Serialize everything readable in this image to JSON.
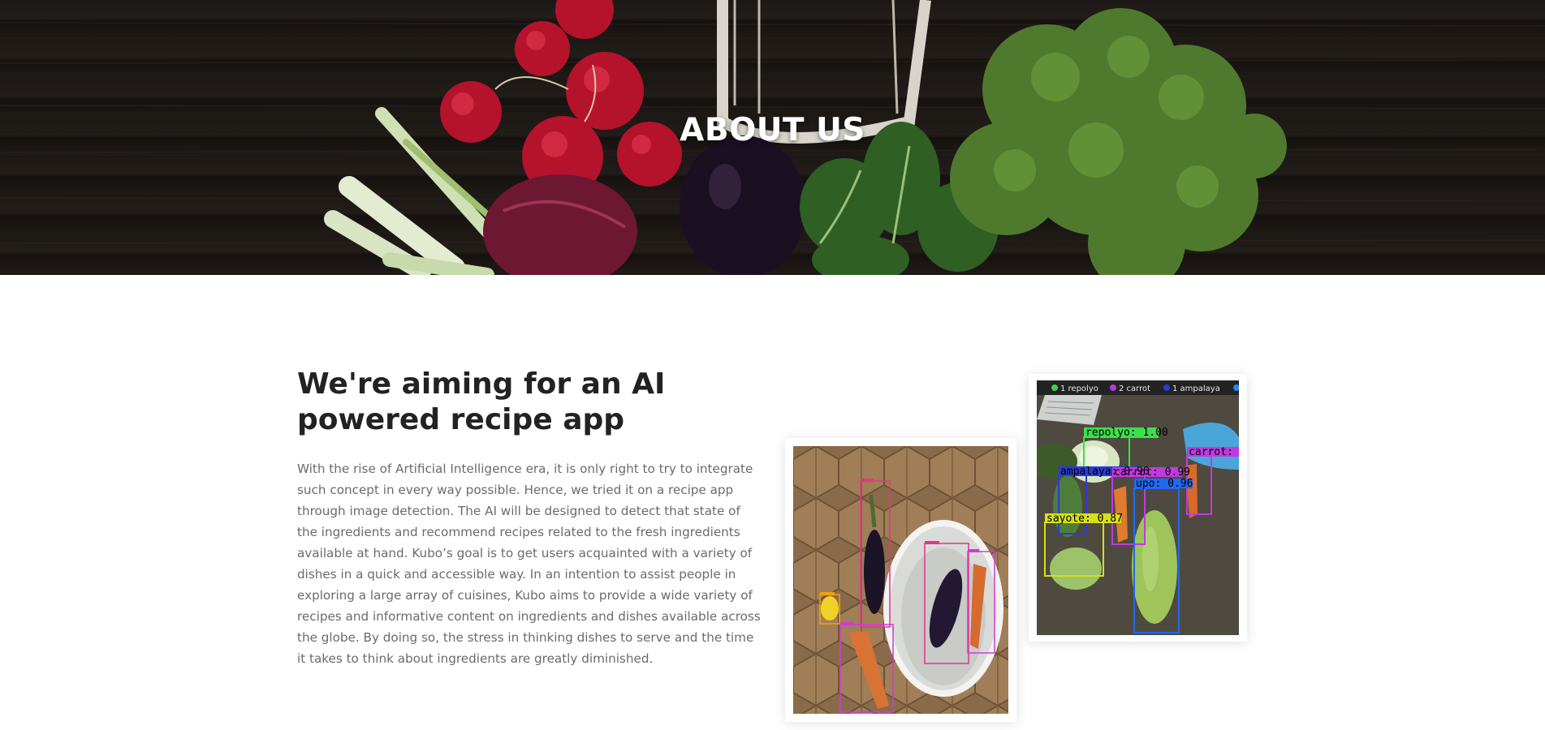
{
  "hero": {
    "title": "ABOUT US"
  },
  "about": {
    "heading_line1": "We're aiming for an AI",
    "heading_line2": "powered recipe app",
    "paragraph": "With the rise of Artificial Intelligence era, it is only right to try to integrate such concept in every way possible. Hence, we tried it on a recipe app through image detection. The AI will be designed to detect that state of the ingredients and recommend recipes related to the fresh ingredients available at hand. Kubo’s goal is to get users acquainted with a variety of dishes in a quick and accessible way. In an intention to assist people in exploring a large array of cuisines, Kubo aims to provide a wide variety of recipes and informative content on ingredients and dishes available across the globe. By doing so, the stress in thinking dishes to serve and the time it takes to think about ingredients are greatly diminished."
  },
  "detection_image": {
    "legend": [
      "1 repolyo",
      "2 carrot",
      "1 ampalaya"
    ],
    "labels": {
      "repolyo": "repolyo: 1.00",
      "ampalaya": "ampalaya: 0.96",
      "carrot1": "carrot: 0.99",
      "carrot2": "carrot:",
      "upo": "upo: 0.96",
      "sayote": "sayote: 0.87"
    }
  },
  "colors": {
    "heading": "#222222",
    "body_text": "#6b6b6b",
    "hero_text": "#ffffff"
  }
}
